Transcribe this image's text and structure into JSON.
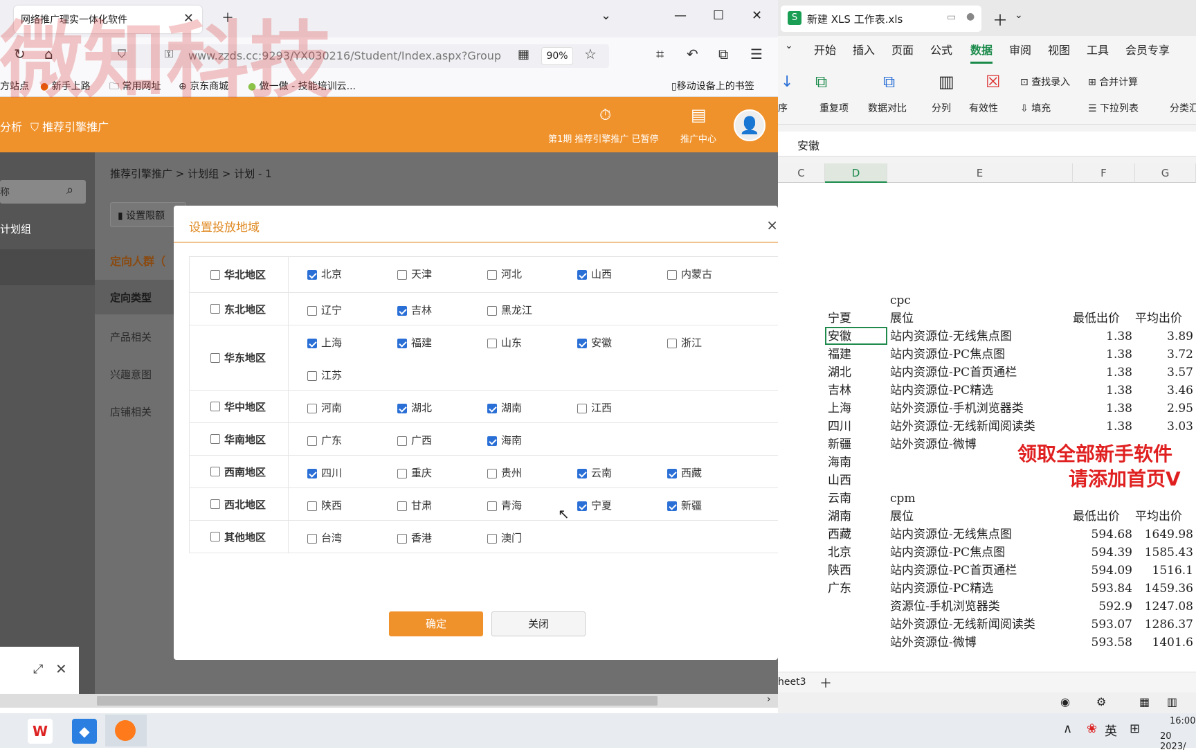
{
  "browser": {
    "tab_title": "网络推广理实一体化软件",
    "url": "www.zzds.cc:9293/YX030216/Student/Index.aspx?Group",
    "zoom": "90%",
    "bookmarks": [
      "方站点",
      "新手上路",
      "常用网址",
      "京东商城",
      "做一做 - 技能培训云...",
      "移动设备上的书签"
    ]
  },
  "app": {
    "nav_left": "分析",
    "nav_active": "推荐引擎推广",
    "period_status": "第1期 推荐引擎推广 已暂停",
    "promo_center": "推广中心",
    "search_placeholder": "称",
    "sidebar_item": "计划组",
    "breadcrumb": "推荐引擎推广 > 计划组 > 计划 - 1",
    "toolbar_btn": "设置限额",
    "section_title": "定向人群（",
    "targeting_type": "定向类型",
    "menu": [
      "产品相关",
      "兴趣意图",
      "店铺相关"
    ]
  },
  "modal": {
    "title": "设置投放地域",
    "close": "×",
    "ok": "确定",
    "cancel": "关闭",
    "regions": [
      {
        "name": "华北地区",
        "checked": false,
        "provinces": [
          {
            "n": "北京",
            "c": true
          },
          {
            "n": "天津",
            "c": false
          },
          {
            "n": "河北",
            "c": false
          },
          {
            "n": "山西",
            "c": true
          },
          {
            "n": "内蒙古",
            "c": false
          }
        ]
      },
      {
        "name": "东北地区",
        "checked": false,
        "provinces": [
          {
            "n": "辽宁",
            "c": false
          },
          {
            "n": "吉林",
            "c": true
          },
          {
            "n": "黑龙江",
            "c": false
          }
        ]
      },
      {
        "name": "华东地区",
        "checked": false,
        "provinces": [
          {
            "n": "上海",
            "c": true
          },
          {
            "n": "福建",
            "c": true
          },
          {
            "n": "山东",
            "c": false
          },
          {
            "n": "安徽",
            "c": true
          },
          {
            "n": "浙江",
            "c": false
          },
          {
            "n": "江苏",
            "c": false
          }
        ]
      },
      {
        "name": "华中地区",
        "checked": false,
        "provinces": [
          {
            "n": "河南",
            "c": false
          },
          {
            "n": "湖北",
            "c": true
          },
          {
            "n": "湖南",
            "c": true
          },
          {
            "n": "江西",
            "c": false
          }
        ]
      },
      {
        "name": "华南地区",
        "checked": false,
        "provinces": [
          {
            "n": "广东",
            "c": false
          },
          {
            "n": "广西",
            "c": false
          },
          {
            "n": "海南",
            "c": true
          }
        ]
      },
      {
        "name": "西南地区",
        "checked": false,
        "provinces": [
          {
            "n": "四川",
            "c": true
          },
          {
            "n": "重庆",
            "c": false
          },
          {
            "n": "贵州",
            "c": false
          },
          {
            "n": "云南",
            "c": true
          },
          {
            "n": "西藏",
            "c": true
          }
        ]
      },
      {
        "name": "西北地区",
        "checked": false,
        "provinces": [
          {
            "n": "陕西",
            "c": false
          },
          {
            "n": "甘肃",
            "c": false
          },
          {
            "n": "青海",
            "c": false
          },
          {
            "n": "宁夏",
            "c": true
          },
          {
            "n": "新疆",
            "c": true
          }
        ]
      },
      {
        "name": "其他地区",
        "checked": false,
        "provinces": [
          {
            "n": "台湾",
            "c": false
          },
          {
            "n": "香港",
            "c": false
          },
          {
            "n": "澳门",
            "c": false
          }
        ]
      }
    ]
  },
  "excel": {
    "tab_title": "新建 XLS 工作表.xls",
    "menu": [
      "开始",
      "插入",
      "页面",
      "公式",
      "数据",
      "审阅",
      "视图",
      "工具",
      "会员专享"
    ],
    "ribbon": [
      "重复项",
      "数据对比",
      "分列",
      "有效性",
      "查找录入",
      "填充",
      "合并计算",
      "下拉列表",
      "分类汇",
      "序"
    ],
    "formula_value": "安徽",
    "columns": [
      "C",
      "D",
      "E",
      "F",
      "G"
    ],
    "sheet_tab": "heet3",
    "rows": [
      [
        "",
        "cpc",
        "",
        ""
      ],
      [
        "宁夏",
        "展位",
        "最低出价",
        "平均出价"
      ],
      [
        "安徽",
        "站内资源位-无线焦点图",
        "1.38",
        "3.89"
      ],
      [
        "福建",
        "站内资源位-PC焦点图",
        "1.38",
        "3.72"
      ],
      [
        "湖北",
        "站内资源位-PC首页通栏",
        "1.38",
        "3.57"
      ],
      [
        "吉林",
        "站内资源位-PC精选",
        "1.38",
        "3.46"
      ],
      [
        "上海",
        "站外资源位-手机浏览器类",
        "1.38",
        "2.95"
      ],
      [
        "四川",
        "站外资源位-无线新闻阅读类",
        "1.38",
        "3.03"
      ],
      [
        "新疆",
        "站外资源位-微博",
        "",
        ""
      ],
      [
        "海南",
        "",
        "",
        ""
      ],
      [
        "山西",
        "",
        "",
        ""
      ],
      [
        "云南",
        "cpm",
        "",
        ""
      ],
      [
        "湖南",
        "展位",
        "最低出价",
        "平均出价"
      ],
      [
        "西藏",
        "站内资源位-无线焦点图",
        "594.68",
        "1649.98"
      ],
      [
        "北京",
        "站内资源位-PC焦点图",
        "594.39",
        "1585.43"
      ],
      [
        "陕西",
        "站内资源位-PC首页通栏",
        "594.09",
        "1516.1"
      ],
      [
        "广东",
        "站内资源位-PC精选",
        "593.84",
        "1459.36"
      ],
      [
        "",
        "资源位-手机浏览器类",
        "592.9",
        "1247.08"
      ],
      [
        "",
        "站外资源位-无线新闻阅读类",
        "593.07",
        "1286.37"
      ],
      [
        "",
        "站外资源位-微博",
        "593.58",
        "1401.6"
      ]
    ],
    "promo_line1": "领取全部新手软件",
    "promo_line2": "请添加首页V"
  },
  "taskbar": {
    "ime": "英",
    "time": "16:00",
    "date": "20 2023/"
  },
  "watermark": "微知科技"
}
